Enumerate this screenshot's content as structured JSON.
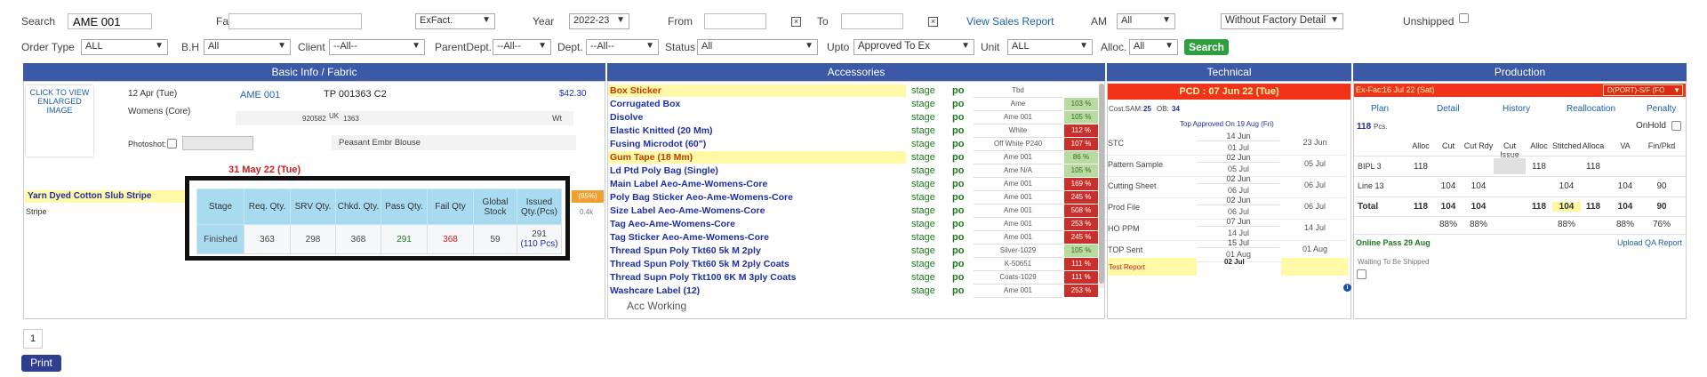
{
  "filters": {
    "row1": {
      "search_label": "Search",
      "search_value": "AME 001",
      "fabric_label": "Fabric",
      "fabric_value": "",
      "exfact_value": "ExFact.",
      "year_label": "Year",
      "year_value": "2022-23",
      "from_label": "From",
      "to_label": "To",
      "view_sales_report": "View Sales Report",
      "am_label": "AM",
      "am_value": "All",
      "factory_detail_value": "Without Factory Detail",
      "unshipped_label": "Unshipped"
    },
    "row2": {
      "order_type_label": "Order Type",
      "order_type_value": "ALL",
      "bh_label": "B.H",
      "bh_value": "All",
      "client_label": "Client",
      "client_value": "--All--",
      "parent_dept_label": "ParentDept.",
      "parent_dept_value": "--All--",
      "dept_label": "Dept.",
      "dept_value": "--All--",
      "status_label": "Status",
      "status_value": "All",
      "upto_label": "Upto",
      "upto_value": "Approved To Ex",
      "unit_label": "Unit",
      "unit_value": "ALL",
      "alloc_label": "Alloc.",
      "alloc_value": "All",
      "search_button": "Search"
    }
  },
  "headers": {
    "basic": "Basic Info / Fabric",
    "accessories": "Accessories",
    "technical": "Technical",
    "production": "Production"
  },
  "basic": {
    "image_alt": "CLICK TO VIEW ENLARGED IMAGE",
    "date": "12 Apr (Tue)",
    "style_code": "AME 001",
    "tp": "TP 001363 C2",
    "price": "$42.30",
    "dept": "Womens (Core)",
    "code1": "920582",
    "uk": "UK",
    "code2": "1363",
    "wt": "Wt",
    "photoshot_label": "Photoshot:",
    "description": "Peasant Embr Blouse",
    "deadline": "31 May 22 (Tue)",
    "fabric_name": "Yarn Dyed Cotton Slub Stripe",
    "fabric_type": "Stripe",
    "fabric_pct": "(95%)",
    "fabric_qty": "0.4k"
  },
  "popup": {
    "headers": [
      "Stage",
      "Req. Qty.",
      "SRV Qty.",
      "Chkd. Qty.",
      "Pass Qty.",
      "Fail Qty",
      "Global Stock",
      "Issued Qty.(Pcs)"
    ],
    "row": {
      "stage": "Finished",
      "req": "363",
      "srv": "298",
      "chkd": "368",
      "pass": "291",
      "fail": "368",
      "global": "59",
      "issued": "291",
      "issued_pcs": "(110 Pcs)"
    }
  },
  "accessories": {
    "rows": [
      {
        "name": "Box Sticker",
        "hl": true,
        "stage": "stage",
        "po": "po",
        "spec": "Tbd",
        "pct": "",
        "color": ""
      },
      {
        "name": "Corrugated Box",
        "hl": false,
        "stage": "stage",
        "po": "po",
        "spec": "Ame",
        "pct": "103 %",
        "color": "#b8dca0"
      },
      {
        "name": "Disolve",
        "hl": false,
        "stage": "stage",
        "po": "po",
        "spec": "Ame 001",
        "pct": "105 %",
        "color": "#b8dca0"
      },
      {
        "name": "Elastic Knitted (20 Mm)",
        "hl": false,
        "stage": "stage",
        "po": "po",
        "spec": "White",
        "pct": "112 %",
        "color": "#c9302c"
      },
      {
        "name": "Fusing Microdot (60\")",
        "hl": false,
        "stage": "stage",
        "po": "po",
        "spec": "Off White P240",
        "pct": "107 %",
        "color": "#c9302c"
      },
      {
        "name": "Gum Tape (18 Mm)",
        "hl": true,
        "stage": "stage",
        "po": "po",
        "spec": "Ame 001",
        "pct": "86 %",
        "color": "#b8dca0"
      },
      {
        "name": "Ld Ptd Poly Bag (Single)",
        "hl": false,
        "stage": "stage",
        "po": "po",
        "spec": "Ame N/A",
        "pct": "105 %",
        "color": "#b8dca0"
      },
      {
        "name": "Main Label Aeo-Ame-Womens-Core",
        "hl": false,
        "stage": "stage",
        "po": "po",
        "spec": "Ame 001",
        "pct": "169 %",
        "color": "#c9302c"
      },
      {
        "name": "Poly Bag Sticker Aeo-Ame-Womens-Core",
        "hl": false,
        "stage": "stage",
        "po": "po",
        "spec": "Ame 001",
        "pct": "245 %",
        "color": "#c9302c"
      },
      {
        "name": "Size Label Aeo-Ame-Womens-Core",
        "hl": false,
        "stage": "stage",
        "po": "po",
        "spec": "Ame 001",
        "pct": "508 %",
        "color": "#c9302c"
      },
      {
        "name": "Tag Aeo-Ame-Womens-Core",
        "hl": false,
        "stage": "stage",
        "po": "po",
        "spec": "Ame 001",
        "pct": "253 %",
        "color": "#c9302c"
      },
      {
        "name": "Tag Sticker Aeo-Ame-Womens-Core",
        "hl": false,
        "stage": "stage",
        "po": "po",
        "spec": "Ame 001",
        "pct": "245 %",
        "color": "#c9302c"
      },
      {
        "name": "Thread Spun Poly Tkt60 5k M 2ply",
        "hl": false,
        "stage": "stage",
        "po": "po",
        "spec": "Silver-1029",
        "pct": "105 %",
        "color": "#b8dca0"
      },
      {
        "name": "Thread Spun Poly Tkt60 5k M 2ply Coats",
        "hl": false,
        "stage": "stage",
        "po": "po",
        "spec": "K-50651",
        "pct": "111 %",
        "color": "#c9302c"
      },
      {
        "name": "Thread Supn Poly Tkt100 6K M 3ply Coats",
        "hl": false,
        "stage": "stage",
        "po": "po",
        "spec": "Coats-1029",
        "pct": "111 %",
        "color": "#c9302c"
      },
      {
        "name": "Washcare Label (12)",
        "hl": false,
        "stage": "stage",
        "po": "po",
        "spec": "Ame 001",
        "pct": "253 %",
        "color": "#c9302c"
      }
    ],
    "working": "Acc Working"
  },
  "technical": {
    "pcd": "PCD : 07 Jun 22 (Tue)",
    "cost_sam_label": "Cost.SAM:",
    "cost_sam": "25",
    "ob_label": "OB:",
    "ob": "34",
    "approved": "Top Approved On 19 Aug (Fri)",
    "rows": [
      {
        "name": "STC",
        "d1": "14 Jun",
        "d2": "01 Jul",
        "d3": "23 Jun"
      },
      {
        "name": "Pattern Sample",
        "d1": "02 Jun",
        "d2": "05 Jul",
        "d3": "05 Jul"
      },
      {
        "name": "Cutting Sheet",
        "d1": "02 Jun",
        "d2": "06 Jul",
        "d3": "06 Jul"
      },
      {
        "name": "Prod File",
        "d1": "02 Jun",
        "d2": "06 Jul",
        "d3": "06 Jul"
      },
      {
        "name": "HO PPM",
        "d1": "07 Jun",
        "d2": "14 Jul",
        "d3": "14 Jul"
      },
      {
        "name": "TOP Sent",
        "d1": "15 Jul",
        "d2": "01 Aug",
        "d3": "01 Aug"
      }
    ],
    "test_report": "Test Report",
    "test_date": "02 Jul"
  },
  "production": {
    "exfac_label": "Ex-Fac:",
    "exfac": "16 Jul 22 (Sat)",
    "port": "D(PORT)-S/F (FO",
    "links": [
      "Plan",
      "Detail",
      "History",
      "Reallocation",
      "Penalty"
    ],
    "pcs": "118",
    "pcs_unit": "Pcs.",
    "onhold": "OnHold",
    "cols": [
      "Alloc",
      "Cut",
      "Cut Rdy",
      "Cut Issue",
      "Alloc",
      "Stitched",
      "Alloca",
      "VA",
      "Fin/Pkd"
    ],
    "rows": [
      {
        "label": "BIPL 3",
        "v": [
          "118",
          "",
          "",
          "",
          "118",
          "",
          "118",
          "",
          ""
        ]
      },
      {
        "label": "Line 13",
        "v": [
          "",
          "104",
          "104",
          "",
          "",
          "104",
          "",
          "104",
          "90"
        ]
      },
      {
        "label": "Total",
        "v": [
          "118",
          "104",
          "104",
          "",
          "118",
          "104",
          "118",
          "104",
          "90"
        ]
      },
      {
        "label": "",
        "v": [
          "",
          "88%",
          "88%",
          "",
          "",
          "88%",
          "",
          "88%",
          "76%"
        ]
      }
    ],
    "online_pass": "Online Pass 29 Aug",
    "upload_qa": "Upload QA Report",
    "waiting": "Waiting To Be Shipped"
  },
  "pager": {
    "page": "1"
  },
  "print_button": "Print"
}
